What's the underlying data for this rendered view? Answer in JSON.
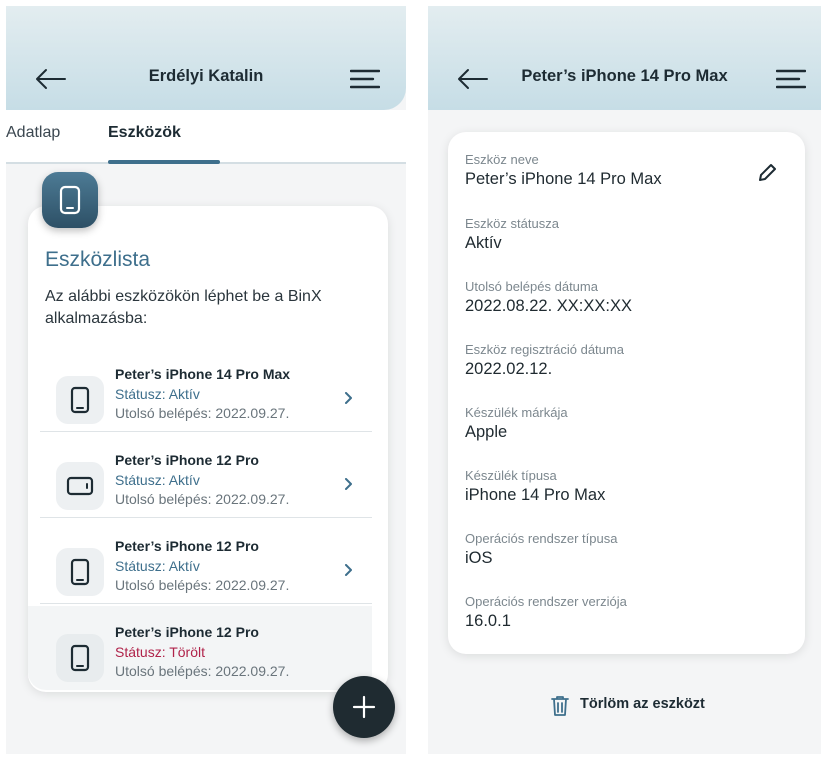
{
  "left": {
    "header": {
      "title": "Erdélyi Katalin"
    },
    "tabs": [
      {
        "label": "Adatlap",
        "active": false
      },
      {
        "label": "Eszközök",
        "active": true
      }
    ],
    "list": {
      "title": "Eszközlista",
      "description": "Az alábbi eszközökön léphet be a BinX alkalmazásba:",
      "devices": [
        {
          "name": "Peter’s iPhone 14 Pro Max",
          "status": "Státusz: Aktív",
          "last_login": "Utolsó belépés: 2022.09.27.",
          "icon": "phone-icon"
        },
        {
          "name": "Peter’s iPhone 12 Pro",
          "status": "Státusz: Aktív",
          "last_login": "Utolsó belépés: 2022.09.27.",
          "icon": "tablet-icon"
        },
        {
          "name": "Peter’s iPhone 12 Pro",
          "status": "Státusz: Aktív",
          "last_login": "Utolsó belépés: 2022.09.27.",
          "icon": "phone-icon"
        },
        {
          "name": "Peter’s iPhone 12 Pro",
          "status": "Státusz: Törölt",
          "last_login": "Utolsó belépés: 2022.09.27.",
          "icon": "phone-icon"
        }
      ]
    },
    "fab": {
      "icon": "plus-icon"
    }
  },
  "right": {
    "header": {
      "title": "Peter’s iPhone 14 Pro Max"
    },
    "fields": [
      {
        "label": "Eszköz neve",
        "value": "Peter’s iPhone 14 Pro Max"
      },
      {
        "label": "Eszköz státusza",
        "value": "Aktív"
      },
      {
        "label": "Utolsó belépés dátuma",
        "value": "2022.08.22. XX:XX:XX"
      },
      {
        "label": "Eszköz regisztráció dátuma",
        "value": "2022.02.12."
      },
      {
        "label": "Készülék márkája",
        "value": "Apple"
      },
      {
        "label": "Készülék típusa",
        "value": "iPhone 14 Pro Max"
      },
      {
        "label": "Operációs rendszer típusa",
        "value": "iOS"
      },
      {
        "label": "Operációs rendszer verziója",
        "value": "16.0.1"
      }
    ],
    "delete_label": "Törlöm az eszközt"
  },
  "colors": {
    "accent": "#3e6f8c",
    "deleted_status": "#b0234a",
    "fab": "#1f2b31",
    "header_gradient_top": "#e3edf0",
    "header_gradient_bottom": "#c6dde6"
  }
}
